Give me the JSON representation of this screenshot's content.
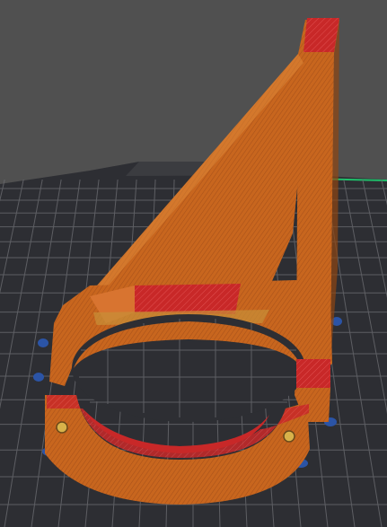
{
  "viewport": {
    "background_color": "#505050",
    "bed_color": "#2d2e33",
    "grid_color": "#6a6b70",
    "bed_edge_color": "#1fbf6a"
  },
  "model": {
    "perimeter_color": "#c8661e",
    "infill_color": "#c82828",
    "highlight_color": "#e08a3a",
    "shadow_color": "#8e4612",
    "support_brim_color": "#2b54a6",
    "insert_color": "#d8b24a"
  }
}
